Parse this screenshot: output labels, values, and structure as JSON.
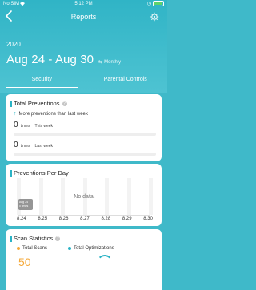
{
  "status_bar": {
    "carrier": "No SIM",
    "time": "5:12 PM"
  },
  "nav": {
    "title": "Reports"
  },
  "period": {
    "year": "2020",
    "range": "Aug 24 - Aug 30",
    "mode": "Monthly"
  },
  "tabs": [
    {
      "label": "Security",
      "active": true
    },
    {
      "label": "Parental Controls",
      "active": false
    }
  ],
  "total_preventions": {
    "title": "Total Preventions",
    "trend_text": "More preventions than last week",
    "this_week": {
      "value": "0",
      "unit": "times",
      "label": "This week"
    },
    "last_week": {
      "value": "0",
      "unit": "times",
      "label": "Last week"
    }
  },
  "per_day": {
    "title": "Preventions Per Day",
    "no_data": "No data.",
    "tooltip_date": "Aug 24",
    "tooltip_value": "0 times",
    "days": [
      "8.24",
      "8.25",
      "8.26",
      "8.27",
      "8.28",
      "8.29",
      "8.30"
    ]
  },
  "scan_statistics": {
    "title": "Scan Statistics",
    "legend_scans": "Total Scans",
    "legend_optimizations": "Total Optimizations",
    "scans_color": "#f5a93a",
    "optimizations_color": "#2ab3c5"
  },
  "colors": {
    "accent": "#2ab3c5",
    "header": "#3fb9c9",
    "orange": "#f5a93a"
  }
}
